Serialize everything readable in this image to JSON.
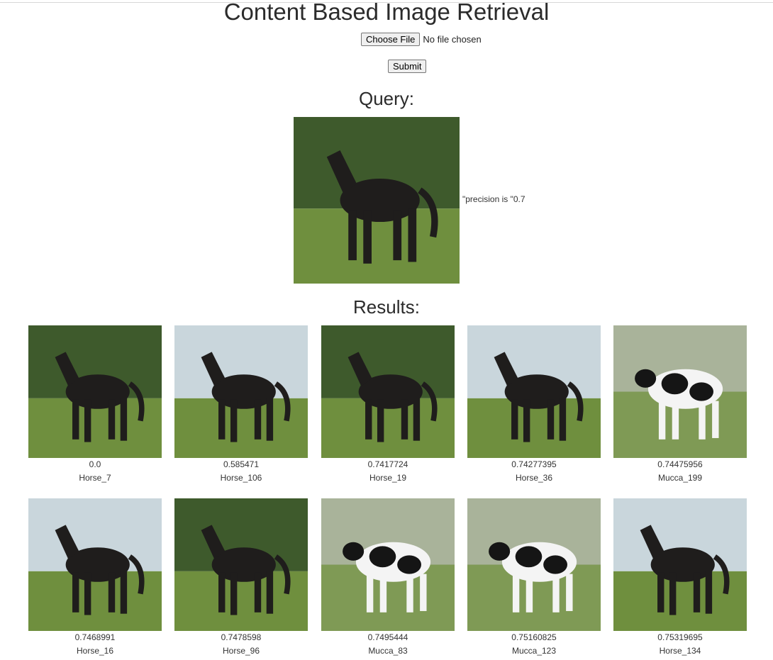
{
  "page": {
    "title": "Content Based Image Retrieval",
    "choose_file_label": "Choose File",
    "file_status": "No file chosen",
    "submit_label": "Submit",
    "query_heading": "Query:",
    "precision_text": "\"precision is \"0.7",
    "results_heading": "Results:"
  },
  "query_image": {
    "subject": "black horse trotting on grass",
    "kind": "horse"
  },
  "results": [
    {
      "score": "0.0",
      "name": "Horse_7",
      "kind": "horse"
    },
    {
      "score": "0.585471",
      "name": "Horse_106",
      "kind": "horse"
    },
    {
      "score": "0.7417724",
      "name": "Horse_19",
      "kind": "horse"
    },
    {
      "score": "0.74277395",
      "name": "Horse_36",
      "kind": "horse"
    },
    {
      "score": "0.74475956",
      "name": "Mucca_199",
      "kind": "cow"
    },
    {
      "score": "0.7468991",
      "name": "Horse_16",
      "kind": "horse"
    },
    {
      "score": "0.7478598",
      "name": "Horse_96",
      "kind": "horse"
    },
    {
      "score": "0.7495444",
      "name": "Mucca_83",
      "kind": "cow"
    },
    {
      "score": "0.75160825",
      "name": "Mucca_123",
      "kind": "cow"
    },
    {
      "score": "0.75319695",
      "name": "Horse_134",
      "kind": "horse"
    }
  ],
  "colors": {
    "horse": "#1f1d1c",
    "grass": "#6f8f3e",
    "sky": "#c9d6dc",
    "cow_white": "#f4f4f4",
    "cow_black": "#151515"
  }
}
